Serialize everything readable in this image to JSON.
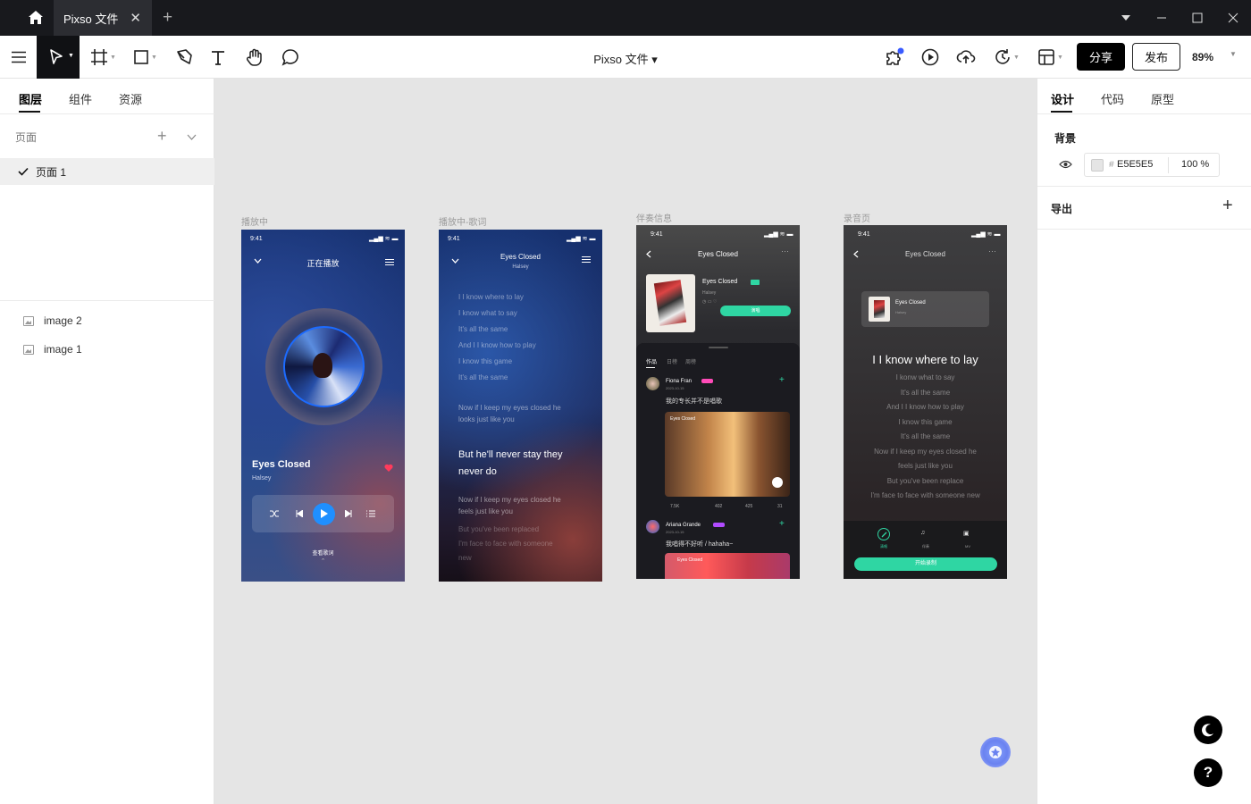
{
  "titlebar": {
    "home_icon": "home-icon",
    "tab_title": "Pixso 文件",
    "close": "✕",
    "add": "+"
  },
  "toolbar": {
    "doc_title": "Pixso 文件 ▾",
    "share": "分享",
    "publish": "发布",
    "zoom": "89%"
  },
  "left_panel": {
    "tabs": [
      "图层",
      "组件",
      "资源"
    ],
    "pages_label": "页面",
    "page": "页面 1",
    "layers": [
      "image 2",
      "image 1"
    ]
  },
  "frames": {
    "playing": {
      "label": "播放中",
      "time": "9:41",
      "header": "正在播放",
      "song": "Eyes Closed",
      "artist": "Halsey",
      "view_lyrics": "查看歌词"
    },
    "lyrics": {
      "label": "播放中-歌词",
      "time": "9:41",
      "song": "Eyes Closed",
      "artist": "Halsey",
      "lines": [
        "I I know where to lay",
        "I know what to say",
        "It's all the same",
        "And I I know how to play",
        "I know this game",
        "It's all the same"
      ],
      "para1": [
        "Now if I keep my eyes closed he",
        "looks just like you"
      ],
      "big": [
        "But he'll never stay they",
        "never do"
      ],
      "para2": [
        "Now if I keep my eyes closed he",
        "feels just like you"
      ],
      "tail": [
        "But you've been replaced",
        "I'm face to face with someone",
        "new"
      ]
    },
    "accompany": {
      "label": "伴奏信息",
      "time": "9:41",
      "title": "Eyes Closed",
      "song": "Eyes Closed",
      "artist": "Halsey",
      "sing_btn": "演唱",
      "tabs": [
        "作品",
        "日榜",
        "周榜"
      ],
      "post1": {
        "user": "Fiona Fran",
        "date": "2023-10-15",
        "text": "我的专长并不是唱歌",
        "video_title": "Eyes Closed",
        "stats": [
          "7.5K",
          "402",
          "425",
          "31"
        ]
      },
      "post2": {
        "user": "Ariana Grande",
        "date": "2023-10-15",
        "text": "我唱得不好听 / hahaha~",
        "video_title": "Eyes Closed"
      }
    },
    "record": {
      "label": "录音页",
      "time": "9:41",
      "title": "Eyes Closed",
      "song": "Eyes Closed",
      "artist": "Halsey",
      "current": "I I know where to lay",
      "lines": [
        "I konw what to say",
        "It's all the same",
        "And I I know how to play",
        "I know this game",
        "It's all the same",
        "Now if I keep my eyes closed he",
        "feels just like you",
        "But you've been replace",
        "I'm face to face with someone new"
      ],
      "modes": [
        "清唱",
        "伴奏",
        "MV"
      ],
      "start_btn": "开始录制"
    }
  },
  "right_panel": {
    "tabs": [
      "设计",
      "代码",
      "原型"
    ],
    "bg_label": "背景",
    "bg_color": "E5E5E5",
    "bg_hash": "#",
    "opacity": "100 %",
    "export_label": "导出"
  },
  "colors": {
    "accent": "#1f8fff",
    "green": "#2fd6a3",
    "canvas": "#e5e5e5",
    "heart": "#ff3b5c"
  }
}
